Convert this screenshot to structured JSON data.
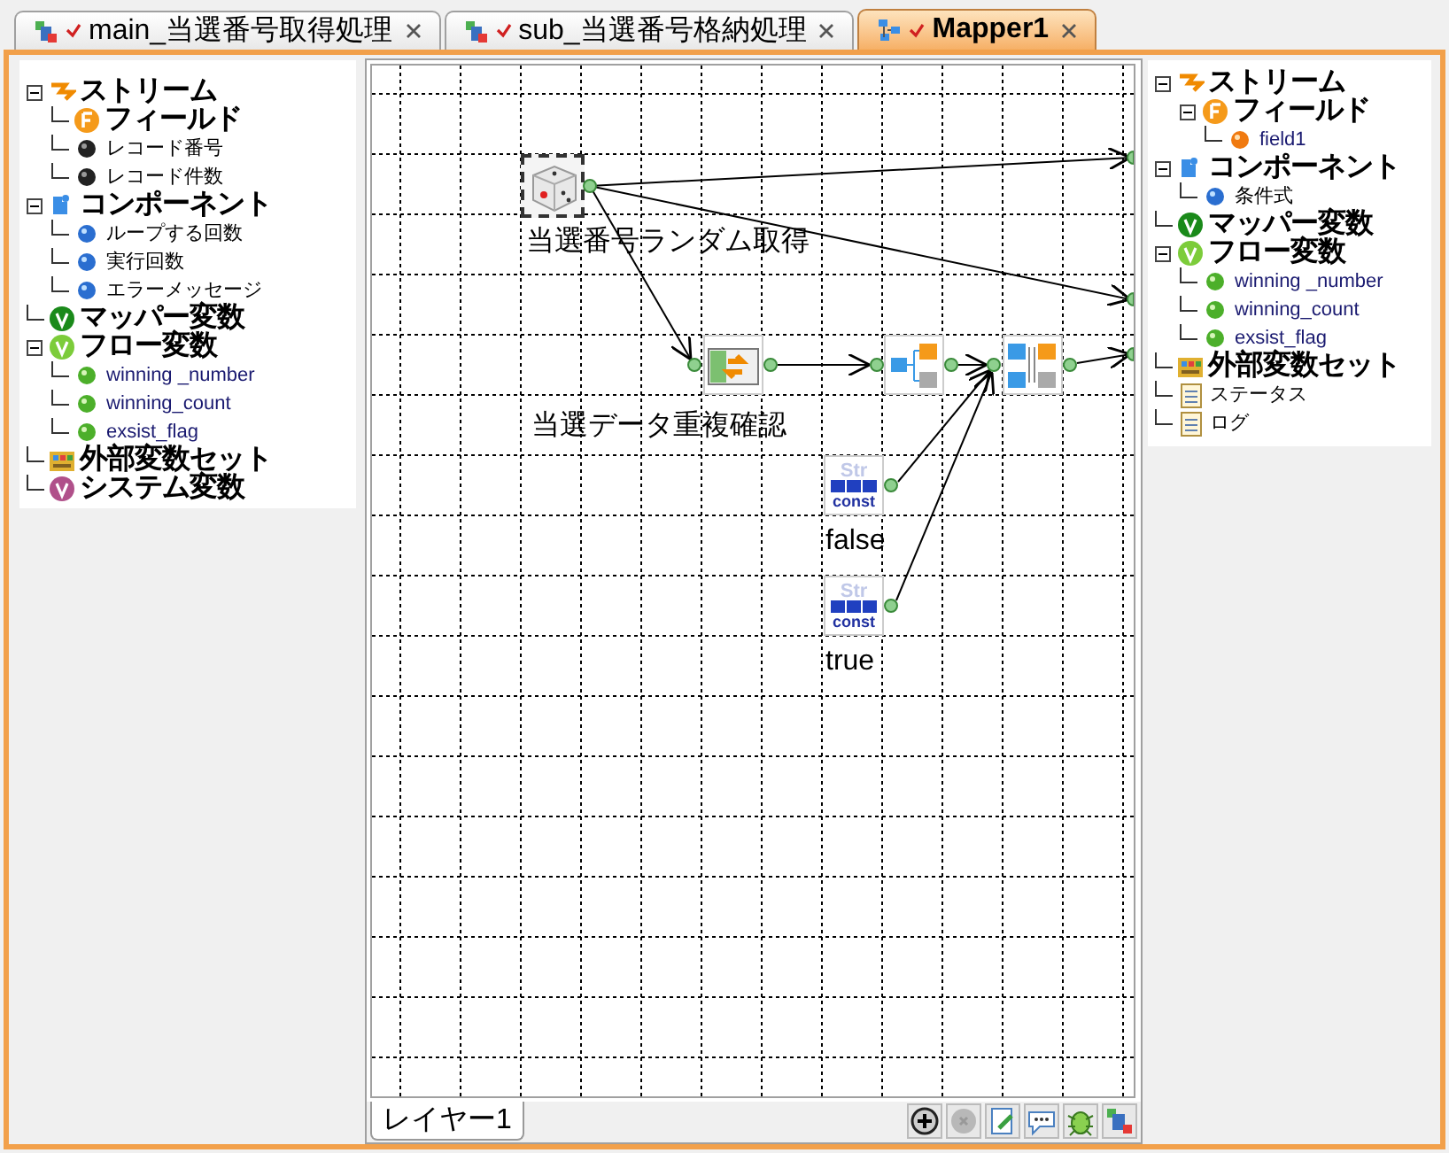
{
  "tabs": [
    {
      "label": "main_当選番号取得処理",
      "selected": false,
      "modified": true
    },
    {
      "label": "sub_当選番号格納処理",
      "selected": false,
      "modified": true
    },
    {
      "label": "Mapper1",
      "selected": true,
      "modified": true
    }
  ],
  "input_tree": [
    {
      "label": "ストリーム",
      "kind": "stream",
      "expanded": true,
      "children": [
        {
          "label": "フィールド",
          "kind": "field"
        },
        {
          "label": "レコード番号",
          "kind": "dot-black"
        },
        {
          "label": "レコード件数",
          "kind": "dot-black"
        }
      ]
    },
    {
      "label": "コンポーネント",
      "kind": "component",
      "expanded": true,
      "children": [
        {
          "label": "ループする回数",
          "kind": "dot-blue"
        },
        {
          "label": "実行回数",
          "kind": "dot-blue"
        },
        {
          "label": "エラーメッセージ",
          "kind": "dot-blue"
        }
      ]
    },
    {
      "label": "マッパー変数",
      "kind": "mapper-var"
    },
    {
      "label": "フロー変数",
      "kind": "flow-var",
      "expanded": true,
      "children": [
        {
          "label": "winning _number",
          "kind": "dot-green"
        },
        {
          "label": "winning_count",
          "kind": "dot-green"
        },
        {
          "label": "exsist_flag",
          "kind": "dot-green"
        }
      ]
    },
    {
      "label": "外部変数セット",
      "kind": "external"
    },
    {
      "label": "システム変数",
      "kind": "system-var"
    }
  ],
  "output_tree": [
    {
      "label": "ストリーム",
      "kind": "stream",
      "expanded": true,
      "children": [
        {
          "label": "フィールド",
          "kind": "field",
          "expanded": true,
          "children": [
            {
              "label": "field1",
              "kind": "dot-orange"
            }
          ]
        }
      ]
    },
    {
      "label": "コンポーネント",
      "kind": "component",
      "expanded": true,
      "children": [
        {
          "label": "条件式",
          "kind": "dot-blue"
        }
      ]
    },
    {
      "label": "マッパー変数",
      "kind": "mapper-var"
    },
    {
      "label": "フロー変数",
      "kind": "flow-var",
      "expanded": true,
      "children": [
        {
          "label": "winning _number",
          "kind": "dot-green"
        },
        {
          "label": "winning_count",
          "kind": "dot-green"
        },
        {
          "label": "exsist_flag",
          "kind": "dot-green"
        }
      ]
    },
    {
      "label": "外部変数セット",
      "kind": "external"
    },
    {
      "label": "ステータス",
      "kind": "document"
    },
    {
      "label": "ログ",
      "kind": "document"
    }
  ],
  "canvas_nodes": [
    {
      "kind": "random",
      "label": "当選番号ランダム取得",
      "selected": true
    },
    {
      "kind": "mapper",
      "label": "当選データ重複確認",
      "selected": false
    },
    {
      "kind": "branch",
      "selected": false
    },
    {
      "kind": "branch2",
      "selected": false
    },
    {
      "kind": "const",
      "label": "false",
      "badge_top": "Str",
      "badge_bottom": "const",
      "selected": false
    },
    {
      "kind": "const",
      "label": "true",
      "badge_top": "Str",
      "badge_bottom": "const",
      "selected": false
    }
  ],
  "layer_tabs": [
    {
      "label": "レイヤー1",
      "selected": true
    }
  ]
}
